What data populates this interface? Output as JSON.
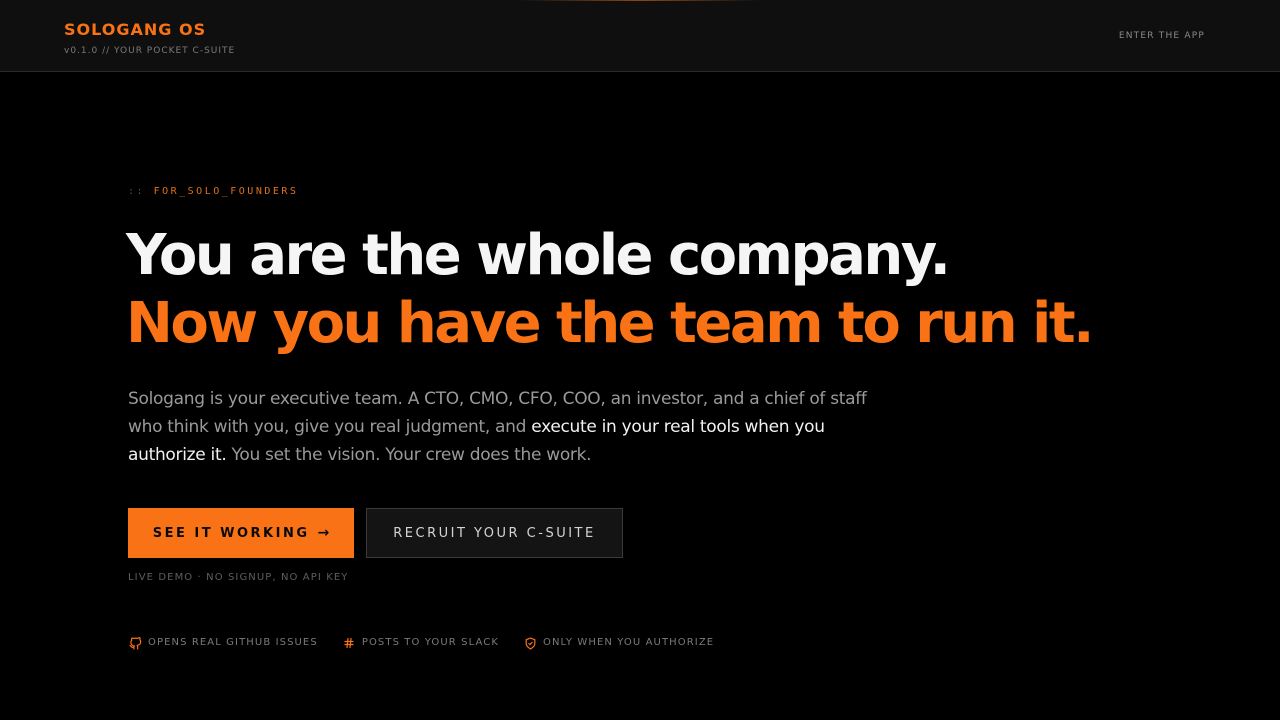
{
  "header": {
    "brand": "SOLOGANG OS",
    "version": "v0.1.0 // YOUR POCKET C-SUITE",
    "enter_app": "ENTER THE APP"
  },
  "hero": {
    "eyebrow_prefix": "::",
    "eyebrow": "FOR_SOLO_FOUNDERS",
    "headline_line1": "You are the whole company.",
    "headline_line2": "Now you have the team to run it.",
    "description_part1": "Sologang is your executive team. A CTO, CMO, CFO, COO, an investor, and a chief of staff who think with you, give you real judgment, and",
    "description_highlight": "execute in your real tools when you authorize it.",
    "description_part2": "You set the vision. Your crew does the work."
  },
  "actions": {
    "primary_label": "SEE IT WORKING",
    "primary_arrow": "→",
    "secondary_label": "RECRUIT YOUR C-SUITE",
    "demo_note": "LIVE DEMO · NO SIGNUP, NO API KEY"
  },
  "features": [
    {
      "icon": "github-icon",
      "label": "OPENS REAL GITHUB ISSUES"
    },
    {
      "icon": "hash-icon",
      "label": "POSTS TO YOUR SLACK"
    },
    {
      "icon": "shield-check-icon",
      "label": "ONLY WHEN YOU AUTHORIZE"
    }
  ],
  "colors": {
    "accent": "#f97316",
    "background": "#000000",
    "header_background": "#0f0f0f",
    "text_primary": "#f5f5f5",
    "text_muted": "#9a9a9a"
  }
}
